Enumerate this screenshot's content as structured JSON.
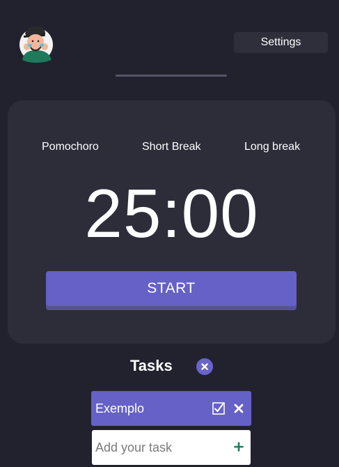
{
  "header": {
    "settings_label": "Settings",
    "session_progress": 0
  },
  "timer": {
    "modes": [
      {
        "label": "Pomochoro"
      },
      {
        "label": "Short Break"
      },
      {
        "label": "Long break"
      }
    ],
    "time": "25:00",
    "start_label": "START"
  },
  "tasks": {
    "heading": "Tasks",
    "items": [
      {
        "label": "Exemplo"
      }
    ],
    "input_placeholder": "Add your task",
    "input_value": ""
  },
  "icons": {
    "avatar": "avatar-illustration",
    "clear_tasks": "close-icon",
    "task_complete": "checkbox-icon",
    "task_delete": "close-icon",
    "add_task": "plus-icon"
  },
  "colors": {
    "background": "#22222f",
    "card": "#2d2d3a",
    "accent": "#6661c6",
    "accent_shadow": "#565297",
    "add_icon": "#1f7a5c"
  }
}
